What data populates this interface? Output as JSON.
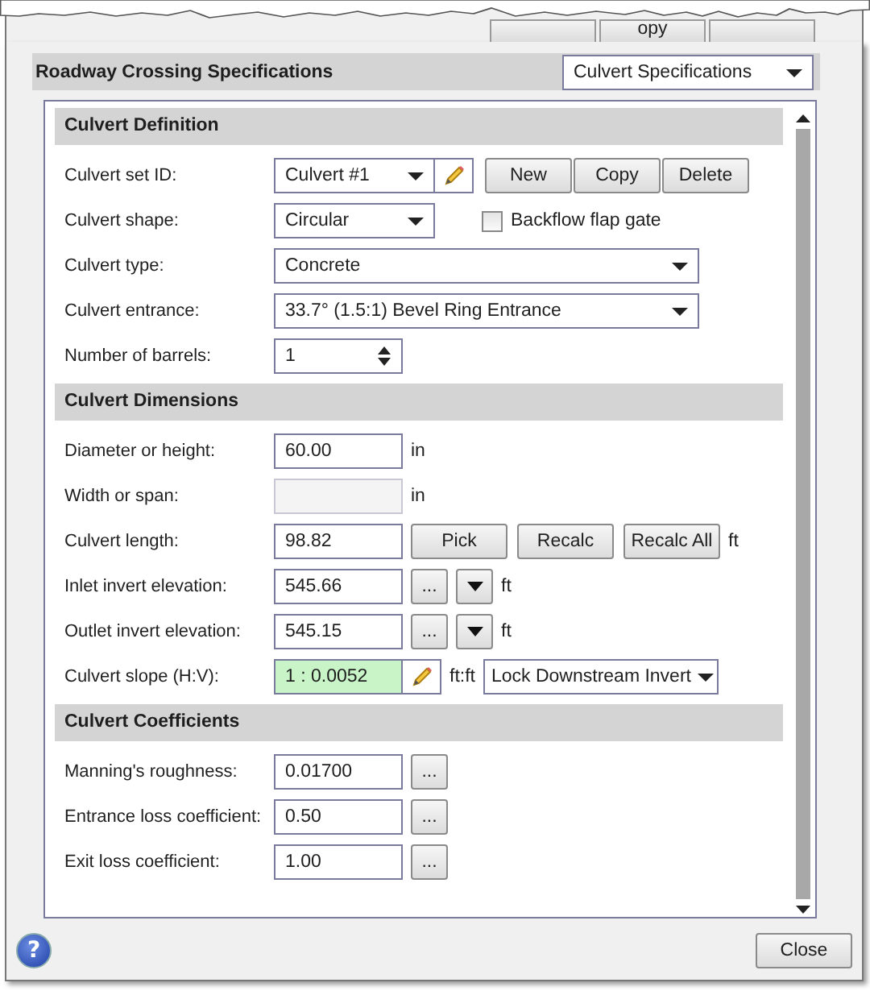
{
  "top_tabs": [
    {
      "kind": "blank"
    },
    {
      "kind": "text",
      "label": "opy"
    },
    {
      "kind": "blank"
    }
  ],
  "header": {
    "title": "Roadway Crossing Specifications",
    "view": "Culvert Specifications"
  },
  "sections": [
    {
      "title": "Culvert Definition",
      "rows": [
        {
          "kind": "id",
          "label": "Culvert set ID:",
          "value": "Culvert #1",
          "buttons": [
            "New",
            "Copy",
            "Delete"
          ]
        },
        {
          "kind": "select_check",
          "label": "Culvert shape:",
          "value": "Circular",
          "checkbox": {
            "label": "Backflow flap gate",
            "checked": false
          }
        },
        {
          "kind": "select_wide",
          "label": "Culvert type:",
          "value": "Concrete"
        },
        {
          "kind": "select_wide",
          "label": "Culvert entrance:",
          "value": "33.7° (1.5:1) Bevel Ring Entrance"
        },
        {
          "kind": "spinner",
          "label": "Number of barrels:",
          "value": "1"
        }
      ]
    },
    {
      "title": "Culvert Dimensions",
      "rows": [
        {
          "kind": "number",
          "label": "Diameter or height:",
          "value": "60.00",
          "unit": "in",
          "disabled": false
        },
        {
          "kind": "number",
          "label": "Width or span:",
          "unit": "in",
          "disabled": true
        },
        {
          "kind": "length",
          "label": "Culvert length:",
          "value": "98.82",
          "buttons": [
            "Pick",
            "Recalc",
            "Recalc All"
          ],
          "unit": "ft"
        },
        {
          "kind": "elevation",
          "label": "Inlet invert elevation:",
          "value": "545.66",
          "more": "...",
          "unit": "ft"
        },
        {
          "kind": "elevation",
          "label": "Outlet invert elevation:",
          "value": "545.15",
          "more": "...",
          "unit": "ft"
        },
        {
          "kind": "slope",
          "label": "Culvert slope (H:V):",
          "value": "1 : 0.0052",
          "highlighted": true,
          "unit": "ft:ft",
          "lock": "Lock Downstream Invert"
        }
      ]
    },
    {
      "title": "Culvert Coefficients",
      "rows": [
        {
          "kind": "coef",
          "label": "Manning's roughness:",
          "value": "0.01700",
          "more": "..."
        },
        {
          "kind": "coef",
          "label": "Entrance loss coefficient:",
          "value": "0.50",
          "more": "..."
        },
        {
          "kind": "coef",
          "label": "Exit loss coefficient:",
          "value": "1.00",
          "more": "..."
        }
      ]
    }
  ],
  "footer": {
    "help": "?",
    "close": "Close"
  }
}
